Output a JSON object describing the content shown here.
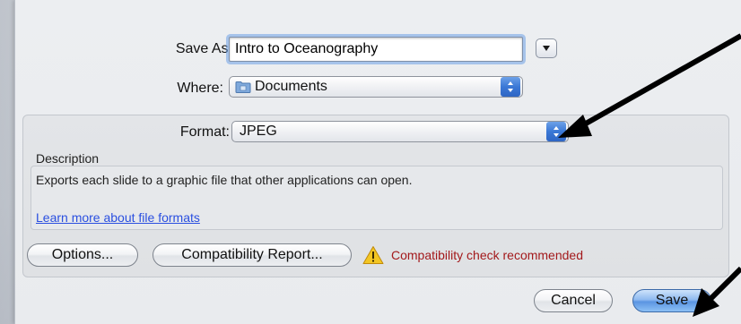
{
  "save_as": {
    "label": "Save As:",
    "value": "Intro to Oceanography"
  },
  "where": {
    "label": "Where:",
    "value": "Documents"
  },
  "format": {
    "label": "Format:",
    "value": "JPEG"
  },
  "description": {
    "label": "Description",
    "text": "Exports each slide to a graphic file that other applications can open.",
    "link": "Learn more about file formats"
  },
  "buttons": {
    "options": "Options...",
    "compatibility": "Compatibility Report...",
    "cancel": "Cancel",
    "save": "Save"
  },
  "warning": {
    "text": "Compatibility check recommended",
    "icon": "warning-icon"
  },
  "colors": {
    "accent": "#3b78d6",
    "warning_text": "#a3191b",
    "link": "#2a4fe0"
  }
}
